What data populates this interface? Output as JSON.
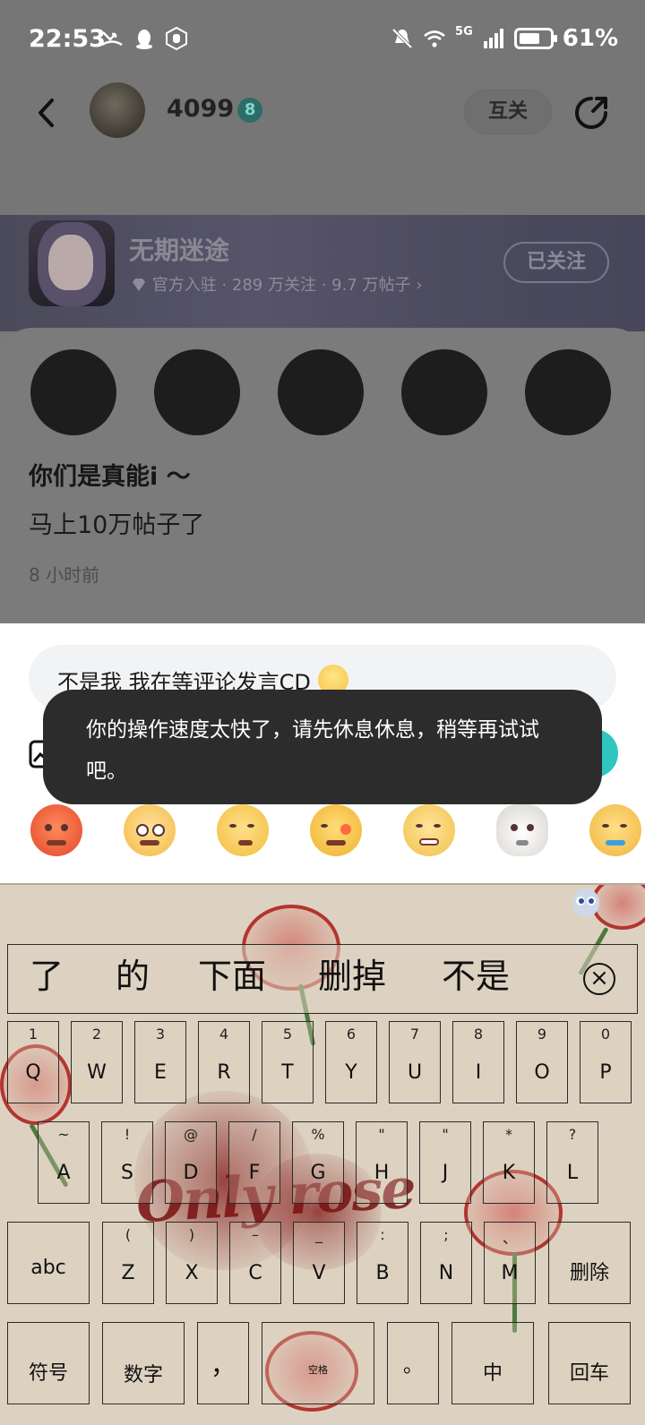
{
  "status_bar": {
    "time": "22:53",
    "network": "5G",
    "battery": "61%"
  },
  "header": {
    "username": "4099",
    "level": "8",
    "mutual_label": "互关"
  },
  "community": {
    "name": "无期迷途",
    "meta": "官方入驻 · 289 万关注 · 9.7 万帖子 ›",
    "follow_label": "已关注"
  },
  "post": {
    "title": "你们是真能i ～",
    "body": "马上10万帖子了",
    "time": "8 小时前"
  },
  "compose": {
    "comment_text": "不是我 我在等评论发言CD",
    "toast": "你的操作速度太快了，请先休息休息，稍等再试试吧。"
  },
  "emoji_bar": [
    {
      "name": "angry-emoji",
      "color": "#f0603c"
    },
    {
      "name": "crying-emoji",
      "color": "#f8c95a"
    },
    {
      "name": "smug-emoji",
      "color": "#f6c850"
    },
    {
      "name": "sparkle-emoji",
      "color": "#f5c23c"
    },
    {
      "name": "grin-emoji",
      "color": "#f5cc5a"
    },
    {
      "name": "dog-emoji",
      "color": "#eceae6"
    },
    {
      "name": "drool-emoji",
      "color": "#f6c45a"
    }
  ],
  "keyboard": {
    "theme_text": "Only rose",
    "candidates": [
      "了",
      "的",
      "下面",
      "删掉",
      "不是"
    ],
    "row1": [
      {
        "sub": "1",
        "key": "Q"
      },
      {
        "sub": "2",
        "key": "W"
      },
      {
        "sub": "3",
        "key": "E"
      },
      {
        "sub": "4",
        "key": "R"
      },
      {
        "sub": "5",
        "key": "T"
      },
      {
        "sub": "6",
        "key": "Y"
      },
      {
        "sub": "7",
        "key": "U"
      },
      {
        "sub": "8",
        "key": "I"
      },
      {
        "sub": "9",
        "key": "O"
      },
      {
        "sub": "0",
        "key": "P"
      }
    ],
    "row2": [
      {
        "sub": "~",
        "key": "A"
      },
      {
        "sub": "!",
        "key": "S"
      },
      {
        "sub": "@",
        "key": "D"
      },
      {
        "sub": "/",
        "key": "F"
      },
      {
        "sub": "%",
        "key": "G"
      },
      {
        "sub": "\"",
        "key": "H"
      },
      {
        "sub": "\"",
        "key": "J"
      },
      {
        "sub": "*",
        "key": "K"
      },
      {
        "sub": "?",
        "key": "L"
      }
    ],
    "row3_left": "abc",
    "row3": [
      {
        "sub": "(",
        "key": "Z"
      },
      {
        "sub": ")",
        "key": "X"
      },
      {
        "sub": "–",
        "key": "C"
      },
      {
        "sub": "_",
        "key": "V"
      },
      {
        "sub": ":",
        "key": "B"
      },
      {
        "sub": ";",
        "key": "N"
      },
      {
        "sub": "、",
        "key": "M"
      }
    ],
    "row3_right": "删除",
    "row4": {
      "symbols": "符号",
      "numbers": "数字",
      "comma": "，",
      "space": "空格",
      "period": "。",
      "chinese": "中",
      "enter": "回车"
    }
  }
}
